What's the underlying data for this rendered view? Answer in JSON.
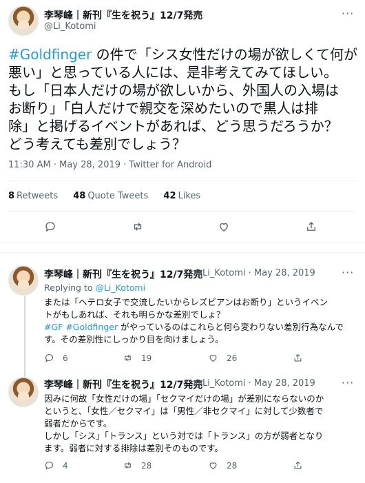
{
  "main_tweet": {
    "author_name": "李琴峰｜新刊『生を祝う』12/7発売",
    "author_handle": "@Li_Kotomi",
    "hashtag": "#Goldfinger",
    "text_line1_rest": " の件で「シス女性だけの場が欲しくて何が",
    "text_line2": "悪い」と思っている人には、是非考えてみてほしい。",
    "text_line3": "もし「日本人だけの場が欲しいから、外国人の入場は",
    "text_line4": "お断り」「白人だけで親交を深めたいので黒人は排",
    "text_line5": "除」と掲げるイベントがあれば、どう思うだろうか？",
    "text_line6": "どう考えても差別でしょう？",
    "timestamp": "11:30 AM · May 28, 2019 · Twitter for Android",
    "retweets_count": "8",
    "retweets_label": "Retweets",
    "quotes_count": "48",
    "quotes_label": "Quote Tweets",
    "likes_count": "42",
    "likes_label": "Likes",
    "more": "···"
  },
  "reply1": {
    "author_name": "李琴峰｜新刊『生を祝う』12/7発売",
    "author_handle": "@Li_Kotomi · May 28, 2019",
    "replying_label": "Replying to ",
    "replying_handle": "@Li_Kotomi",
    "line1": "または「ヘテロ女子で交流したいからレズビアンはお断り」というイベン",
    "line2": "トがもしあれば、それも明らかな差別でしょ？",
    "hashtags": "#GF #Goldfinger",
    "line3_rest": " がやっているのはこれらと何ら変わりない差別行為なんで",
    "line4": "す。その差別性にしっかり目を向けましょう。",
    "reply_count": "6",
    "retweet_count": "19",
    "like_count": "26",
    "more": "···"
  },
  "reply2": {
    "author_name": "李琴峰｜新刊『生を祝う』12/7発売",
    "author_handle": "@Li_Kotomi · May 28, 2019",
    "line1": "因みに何故「女性だけの場」「セクマイだけの場」が差別にならないのか",
    "line2": "というと、「女性／セクマイ」は「男性／非セクマイ」に対して少数者で",
    "line3": "弱者だからです。",
    "line4": "しかし「シス」「トランス」という対では「トランス」の方が弱者となり",
    "line5": "ます。弱者に対する排除は差別そのものです。",
    "reply_count": "4",
    "retweet_count": "28",
    "like_count": "28",
    "more": "···"
  }
}
